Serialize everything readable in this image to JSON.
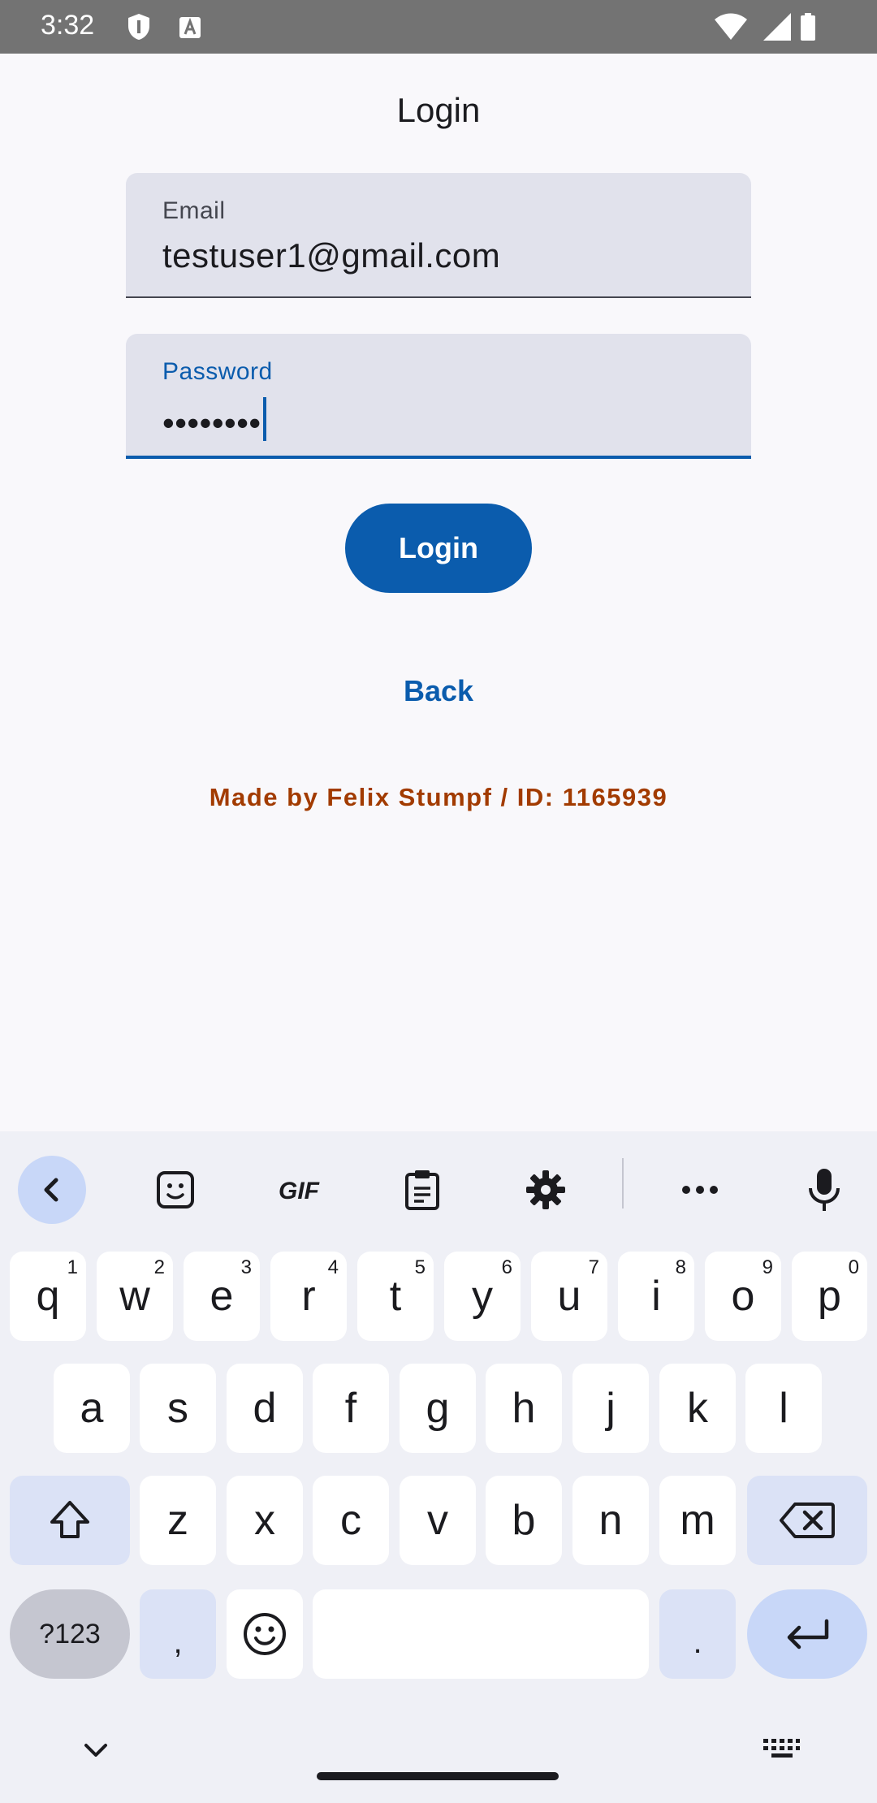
{
  "status_bar": {
    "time": "3:32"
  },
  "header": {
    "title": "Login"
  },
  "form": {
    "email": {
      "label": "Email",
      "value": "testuser1@gmail.com"
    },
    "password": {
      "label": "Password",
      "value": "••••••••"
    },
    "login_label": "Login",
    "back_label": "Back"
  },
  "footer": {
    "credit": "Made by Felix Stumpf / ID: 1165939"
  },
  "keyboard": {
    "toolbar": [
      "back-chevron-icon",
      "sticker-icon",
      "gif-icon",
      "clipboard-icon",
      "gear-icon",
      "more-icon",
      "microphone-icon"
    ],
    "row1": [
      "q",
      "w",
      "e",
      "r",
      "t",
      "y",
      "u",
      "i",
      "o",
      "p"
    ],
    "row1_hints": [
      "1",
      "2",
      "3",
      "4",
      "5",
      "6",
      "7",
      "8",
      "9",
      "0"
    ],
    "row2": [
      "a",
      "s",
      "d",
      "f",
      "g",
      "h",
      "j",
      "k",
      "l"
    ],
    "row3": [
      "z",
      "x",
      "c",
      "v",
      "b",
      "n",
      "m"
    ],
    "symbols_label": "?123",
    "comma_label": ",",
    "period_label": "."
  },
  "colors": {
    "accent": "#0b5cad",
    "credit": "#a23b00",
    "field_bg": "#e1e2ec"
  }
}
